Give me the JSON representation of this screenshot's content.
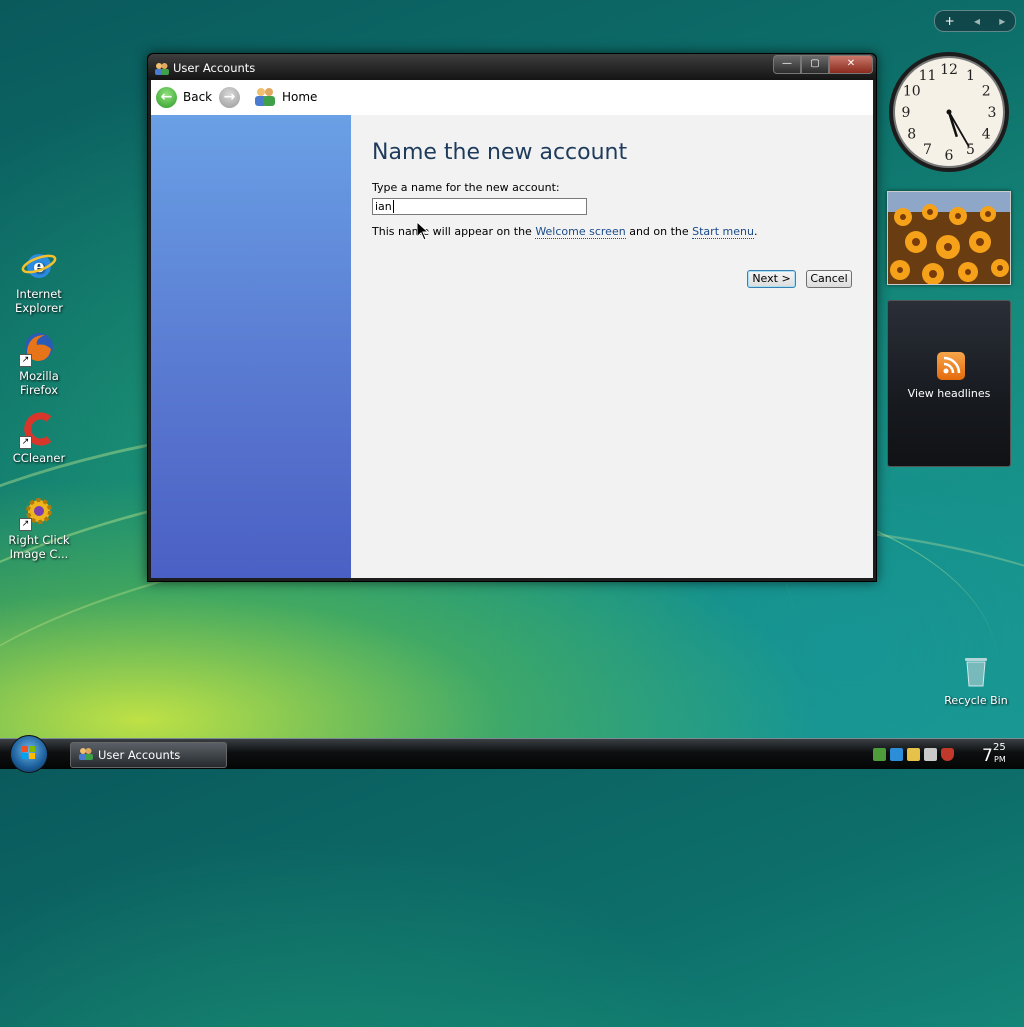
{
  "desktop": {
    "icons": [
      {
        "label_line1": "Internet",
        "label_line2": "Explorer"
      },
      {
        "label_line1": "Mozilla",
        "label_line2": "Firefox"
      },
      {
        "label_line1": "CCleaner",
        "label_line2": ""
      },
      {
        "label_line1": "Right Click",
        "label_line2": "Image C..."
      }
    ],
    "recycle_bin_label": "Recycle Bin"
  },
  "window": {
    "title": "User Accounts",
    "caption": {
      "minimize": "—",
      "maximize": "▢",
      "close": "✕"
    },
    "nav": {
      "back_label": "Back",
      "home_label": "Home"
    }
  },
  "content": {
    "heading": "Name the new account",
    "prompt": "Type a name for the new account:",
    "name_value": "ian",
    "info_prefix": "This name will appear on the ",
    "info_link1": "Welcome screen",
    "info_mid": " and on the ",
    "info_link2": "Start menu",
    "info_suffix": ".",
    "next_label": "Next >",
    "cancel_label": "Cancel"
  },
  "gadgets": {
    "sidebar_controls": {
      "add": "+",
      "prev": "◂",
      "next": "▸"
    },
    "clock": {
      "numbers": [
        "12",
        "1",
        "2",
        "3",
        "4",
        "5",
        "6",
        "7",
        "8",
        "9",
        "10",
        "11"
      ],
      "hour": 5,
      "minute": 25
    },
    "feed_label": "View headlines"
  },
  "taskbar": {
    "task_label": "User Accounts",
    "time_hour": "7",
    "time_minute": "25",
    "time_ampm": "PM"
  },
  "colors": {
    "sidebar_top": "#6aa0e5",
    "sidebar_bottom": "#4b60c4",
    "heading": "#1e3b5c",
    "link": "#1a4a8a",
    "next_border": "#3c7fb1"
  }
}
